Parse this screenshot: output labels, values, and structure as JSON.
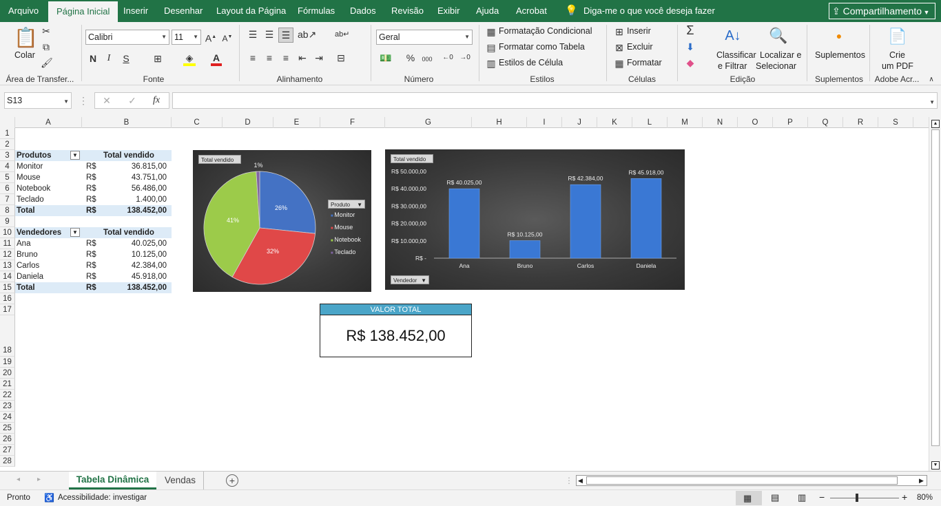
{
  "ribbon_tabs": [
    "Arquivo",
    "Página Inicial",
    "Inserir",
    "Desenhar",
    "Layout da Página",
    "Fórmulas",
    "Dados",
    "Revisão",
    "Exibir",
    "Ajuda",
    "Acrobat"
  ],
  "tell_me": "Diga-me o que você deseja fazer",
  "share_label": "Compartilhamento",
  "clipboard": {
    "paste": "Colar",
    "group": "Área de Transfer..."
  },
  "font": {
    "name": "Calibri",
    "size": "11",
    "group": "Fonte",
    "bold": "N",
    "italic": "I",
    "underline": "S"
  },
  "align": {
    "group": "Alinhamento"
  },
  "number": {
    "format": "Geral",
    "group": "Número",
    "percent": "%",
    "thousands": "000"
  },
  "styles": {
    "cond": "Formatação Condicional",
    "table": "Formatar como Tabela",
    "cell": "Estilos de Célula",
    "group": "Estilos"
  },
  "cells": {
    "insert": "Inserir",
    "delete": "Excluir",
    "format": "Formatar",
    "group": "Células"
  },
  "editing": {
    "sort1": "Classificar",
    "sort2": "e Filtrar",
    "find1": "Localizar e",
    "find2": "Selecionar",
    "group": "Edição"
  },
  "addins": {
    "label": "Suplementos",
    "group": "Suplementos"
  },
  "adobe": {
    "l1": "Crie",
    "l2": "um PDF",
    "group": "Adobe Acr..."
  },
  "namebox": "S13",
  "fx": "fx",
  "columns": [
    "A",
    "B",
    "C",
    "D",
    "E",
    "F",
    "G",
    "H",
    "I",
    "J",
    "K",
    "L",
    "M",
    "N",
    "O",
    "P",
    "Q",
    "R",
    "S"
  ],
  "rows": [
    "1",
    "2",
    "3",
    "4",
    "5",
    "6",
    "7",
    "8",
    "9",
    "10",
    "11",
    "12",
    "13",
    "14",
    "15",
    "16",
    "17",
    "18",
    "19",
    "20",
    "21",
    "22",
    "23",
    "24",
    "25",
    "26",
    "27",
    "28"
  ],
  "pivot1": {
    "h1": "Produtos",
    "h2": "Total vendido",
    "rows": [
      [
        "Monitor",
        "R$",
        "36.815,00"
      ],
      [
        "Mouse",
        "R$",
        "43.751,00"
      ],
      [
        "Notebook",
        "R$",
        "56.486,00"
      ],
      [
        "Teclado",
        "R$",
        "1.400,00"
      ]
    ],
    "total": [
      "Total",
      "R$",
      "138.452,00"
    ]
  },
  "pivot2": {
    "h1": "Vendedores",
    "h2": "Total vendido",
    "rows": [
      [
        "Ana",
        "R$",
        "40.025,00"
      ],
      [
        "Bruno",
        "R$",
        "10.125,00"
      ],
      [
        "Carlos",
        "R$",
        "42.384,00"
      ],
      [
        "Daniela",
        "R$",
        "45.918,00"
      ]
    ],
    "total": [
      "Total",
      "R$",
      "138.452,00"
    ]
  },
  "chart_data": [
    {
      "type": "pie",
      "field_button": "Total vendido",
      "legend_button": "Produto",
      "categories": [
        "Monitor",
        "Mouse",
        "Notebook",
        "Teclado"
      ],
      "values": [
        36815,
        43751,
        56486,
        1400
      ],
      "data_labels": [
        "26%",
        "32%",
        "41%",
        "1%"
      ],
      "colors": [
        "#4472c4",
        "#e04848",
        "#9ccb4a",
        "#8064a2"
      ],
      "legend": "right"
    },
    {
      "type": "bar",
      "field_button": "Total vendido",
      "axis_button": "Vendedor",
      "categories": [
        "Ana",
        "Bruno",
        "Carlos",
        "Daniela"
      ],
      "values": [
        40025,
        10125,
        42384,
        45918
      ],
      "data_labels": [
        "R$ 40.025,00",
        "R$ 10.125,00",
        "R$ 42.384,00",
        "R$ 45.918,00"
      ],
      "ylim": [
        0,
        50000
      ],
      "yticks": [
        "R$ -",
        "R$ 10.000,00",
        "R$ 20.000,00",
        "R$ 30.000,00",
        "R$ 40.000,00",
        "R$ 50.000,00"
      ],
      "color": "#3a78d4"
    }
  ],
  "kpi": {
    "title": "VALOR TOTAL",
    "value": "R$ 138.452,00"
  },
  "sheets": [
    "Tabela Dinâmica",
    "Vendas"
  ],
  "status": {
    "ready": "Pronto",
    "accessibility": "Acessibilidade: investigar",
    "zoom": "80%"
  }
}
